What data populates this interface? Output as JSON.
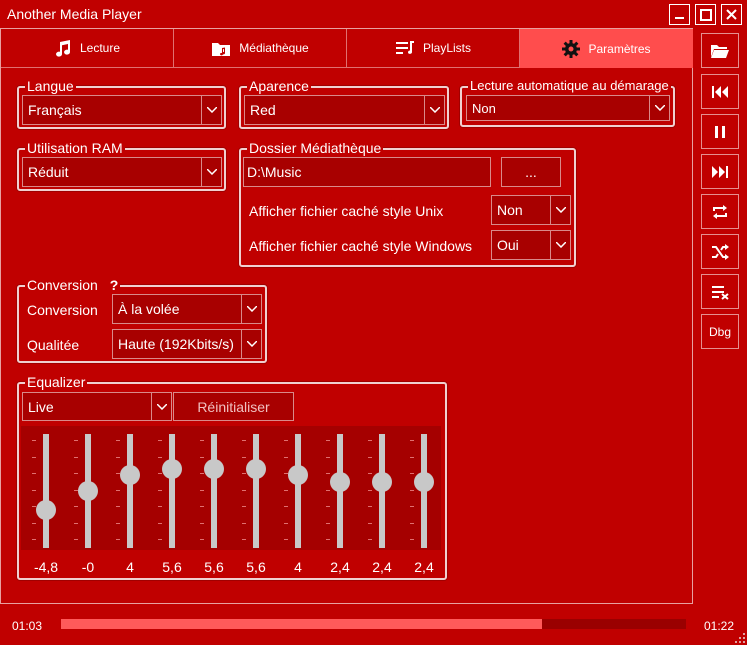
{
  "window": {
    "title": "Another Media Player"
  },
  "tabs": [
    {
      "label": "Lecture",
      "icon": "music-note-icon"
    },
    {
      "label": "Médiathèque",
      "icon": "folder-music-icon"
    },
    {
      "label": "PlayLists",
      "icon": "playlist-icon"
    },
    {
      "label": "Paramètres",
      "icon": "gear-icon",
      "active": true
    }
  ],
  "sidebar": {
    "buttons": [
      "open-folder-icon",
      "previous-icon",
      "pause-icon",
      "next-icon",
      "repeat-icon",
      "shuffle-icon",
      "clear-queue-icon"
    ],
    "debug_label": "Dbg"
  },
  "settings": {
    "langue": {
      "title": "Langue",
      "value": "Français"
    },
    "aparence": {
      "title": "Aparence",
      "value": "Red"
    },
    "autoplay": {
      "title": "Lecture automatique au démarage",
      "value": "Non"
    },
    "ram": {
      "title": "Utilisation RAM",
      "value": "Réduit"
    },
    "library": {
      "title": "Dossier Médiathèque",
      "path": "D:\\Music",
      "browse_label": "...",
      "unix_label": "Afficher fichier caché style Unix",
      "unix_value": "Non",
      "windows_label": "Afficher fichier caché style Windows",
      "windows_value": "Oui"
    },
    "conversion": {
      "title": "Conversion",
      "help": "?",
      "mode_label": "Conversion",
      "mode_value": "À la volée",
      "quality_label": "Qualitée",
      "quality_value": "Haute (192Kbits/s)"
    },
    "equalizer": {
      "title": "Equalizer",
      "preset": "Live",
      "reset_label": "Réinitialiser",
      "range_db": [
        -12,
        12
      ],
      "bands": [
        {
          "label": "-4,8",
          "value": -4.8
        },
        {
          "label": "-0",
          "value": 0
        },
        {
          "label": "4",
          "value": 4
        },
        {
          "label": "5,6",
          "value": 5.6
        },
        {
          "label": "5,6",
          "value": 5.6
        },
        {
          "label": "5,6",
          "value": 5.6
        },
        {
          "label": "4",
          "value": 4
        },
        {
          "label": "2,4",
          "value": 2.4
        },
        {
          "label": "2,4",
          "value": 2.4
        },
        {
          "label": "2,4",
          "value": 2.4
        }
      ]
    }
  },
  "status": {
    "elapsed": "01:03",
    "total": "01:22",
    "progress": 0.77
  },
  "colors": {
    "background": "#c00000",
    "active_tab": "#ff4d4d",
    "progress": "#ff5a5a"
  }
}
